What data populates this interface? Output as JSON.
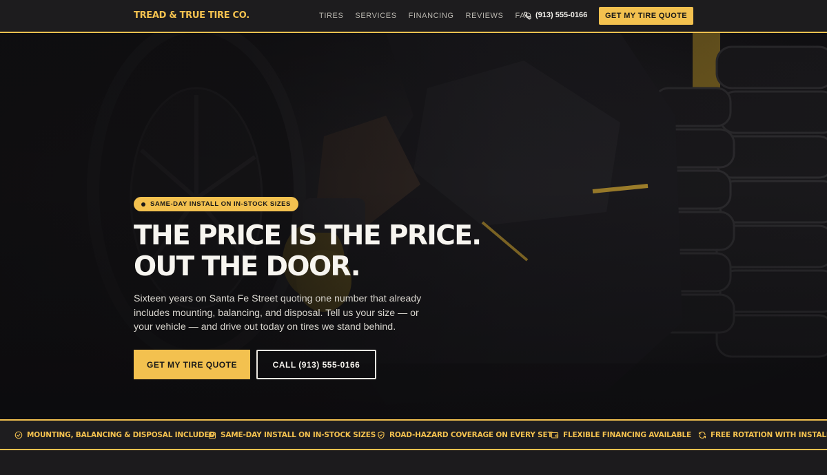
{
  "brand": {
    "name": "TREAD & TRUE TIRE CO.",
    "accent_color": "#f3c14f",
    "background_color": "#1c1b1d"
  },
  "nav": {
    "links": [
      "TIRES",
      "SERVICES",
      "FINANCING",
      "REVIEWS",
      "FAQ"
    ],
    "phone": "(913) 555-0166",
    "phone_icon": "phone-icon",
    "cta_label": "GET MY TIRE QUOTE"
  },
  "hero": {
    "badge": "SAME-DAY INSTALL ON IN-STOCK SIZES",
    "headline": "THE PRICE IS THE PRICE. OUT THE DOOR.",
    "subheadline": "Sixteen years on Santa Fe Street quoting one number that already includes mounting, balancing, and disposal. Tell us your size — or your vehicle — and drive out today on tires we stand behind.",
    "primary_cta": "GET MY TIRE QUOTE",
    "secondary_cta": "CALL (913) 555-0166",
    "background_image": "mechanic installing tire on wheel in dark garage with stacked tires"
  },
  "features": [
    {
      "label": "MOUNTING, BALANCING & DISPOSAL INCLUDED",
      "icon": "check-circle-icon"
    },
    {
      "label": "SAME-DAY INSTALL ON IN-STOCK SIZES",
      "icon": "calendar-icon"
    },
    {
      "label": "ROAD-HAZARD COVERAGE ON EVERY SET",
      "icon": "shield-check-icon"
    },
    {
      "label": "FLEXIBLE FINANCING AVAILABLE",
      "icon": "wallet-icon"
    },
    {
      "label": "FREE ROTATION WITH INSTALL",
      "icon": "rotate-icon"
    }
  ]
}
